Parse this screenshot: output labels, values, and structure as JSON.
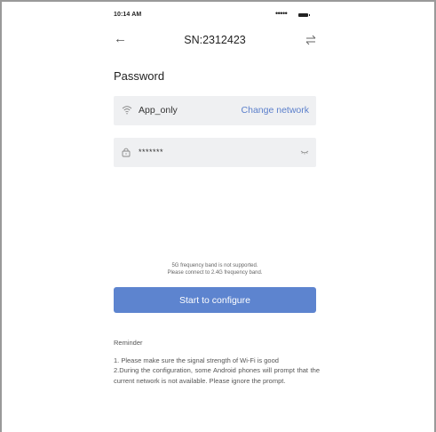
{
  "status_bar": {
    "time": "10:14 AM",
    "signal": "•••••",
    "battery_icon": "battery-icon"
  },
  "nav": {
    "title": "SN:2312423",
    "back_icon": "back-arrow-icon",
    "switch_icon": "switch-arrows-icon"
  },
  "section_title": "Password",
  "wifi_field": {
    "icon": "wifi-icon",
    "network_name": "App_only",
    "change_label": "Change network"
  },
  "password_field": {
    "icon": "lock-icon",
    "value": "*******",
    "toggle_icon": "eye-closed-icon"
  },
  "band_note": {
    "line1": "5G frequency band is not supported.",
    "line2": "Please connect to 2.4G frequency band."
  },
  "start_button": {
    "label": "Start to configure"
  },
  "reminder": {
    "title": "Reminder",
    "lines": [
      "1. Please make sure the signal strength of Wi-Fi is good",
      "2.During the configuration, some Android phones will prompt that the current network is not available. Please ignore the prompt."
    ]
  },
  "colors": {
    "accent": "#5d84cf",
    "link": "#5b7fcb",
    "field_bg": "#eff0f2"
  }
}
